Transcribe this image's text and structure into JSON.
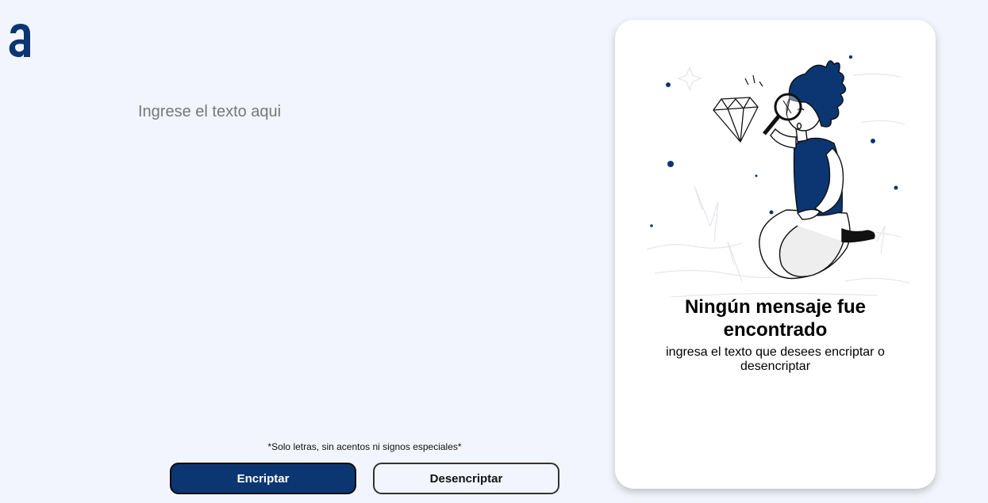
{
  "logo": {
    "icon": "alura-logo-icon",
    "color": "#0b3672"
  },
  "input": {
    "placeholder": "Ingrese el texto aqui",
    "value": ""
  },
  "hint": "*Solo letras, sin acentos ni signos especiales*",
  "buttons": {
    "encrypt": "Encriptar",
    "decrypt": "Desencriptar"
  },
  "result": {
    "illustration": "person-searching-with-magnifier-illustration",
    "title": "Ningún mensaje fue encontrado",
    "subtitle": "ingresa el texto que desees encriptar o desencriptar"
  },
  "colors": {
    "accent": "#0b3672",
    "background": "#f2f5fd",
    "card": "#ffffff"
  }
}
